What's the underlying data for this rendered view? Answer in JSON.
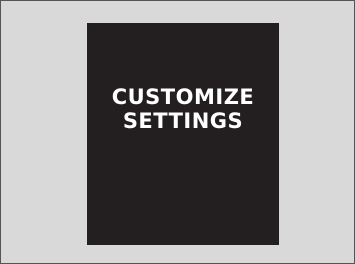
{
  "display": {
    "line1": "CUSTOMIZE",
    "line2": "SETTINGS"
  },
  "colors": {
    "background": "#d9d9d9",
    "screen": "#231f20",
    "text": "#ffffff"
  }
}
